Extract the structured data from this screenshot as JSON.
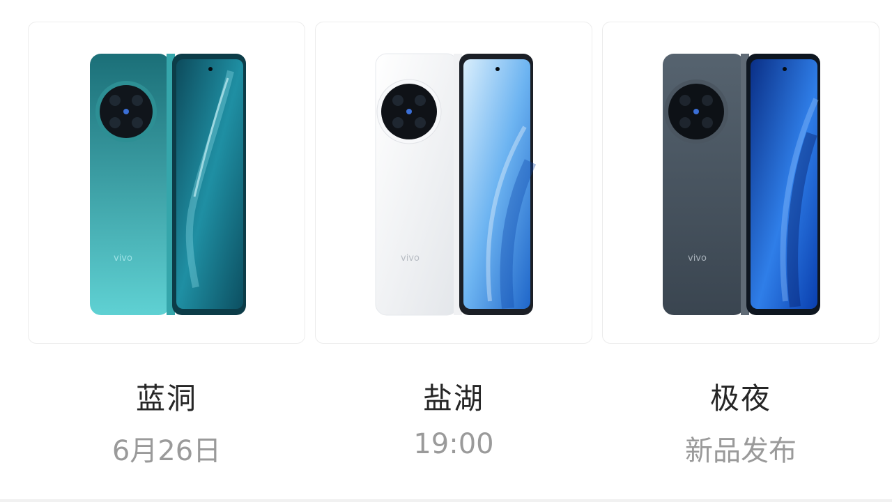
{
  "products": [
    {
      "name": "蓝洞",
      "subtitle": "6月26日",
      "brand": "vivo",
      "colors": {
        "body": "#2c9ca0",
        "body_dark": "#1b6f78",
        "screen": "#0e5a6b",
        "screen_light": "#2aa2b4"
      }
    },
    {
      "name": "盐湖",
      "subtitle": "19:00",
      "brand": "vivo",
      "colors": {
        "body": "#f4f5f7",
        "body_dark": "#dcdfe4",
        "screen": "#2f7fd6",
        "screen_light": "#bfe0fb"
      }
    },
    {
      "name": "极夜",
      "subtitle": "新品发布",
      "brand": "vivo",
      "colors": {
        "body": "#4d5a66",
        "body_dark": "#39444f",
        "screen": "#0a47c4",
        "screen_light": "#5fa6f4"
      }
    }
  ]
}
